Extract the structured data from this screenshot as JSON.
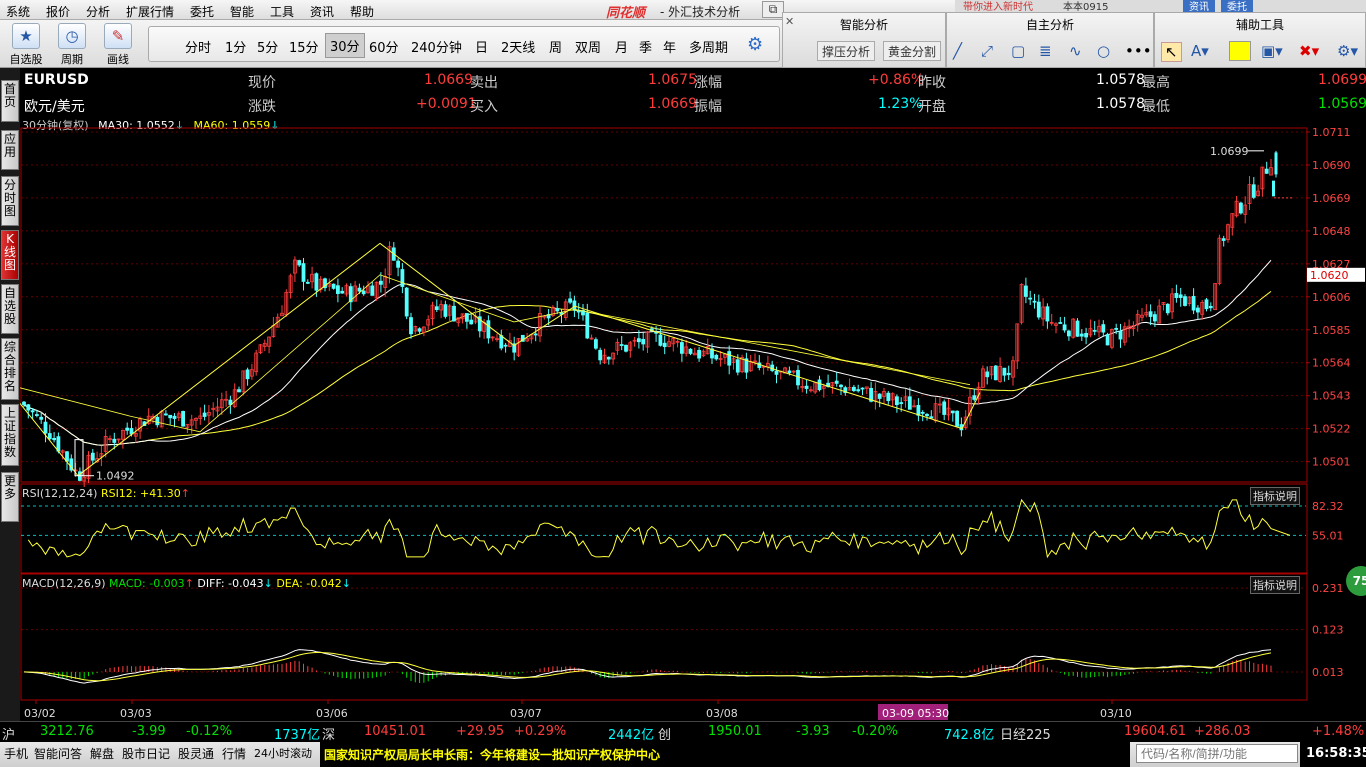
{
  "menu": [
    "系统",
    "报价",
    "分析",
    "扩展行情",
    "委托",
    "智能",
    "工具",
    "资讯",
    "帮助"
  ],
  "brand": "同花顺",
  "app_title": "- 外汇技术分析",
  "topright": {
    "t1": "带你进入新时代",
    "t2": "本本0915",
    "btn1": "资讯",
    "btn2": "委托"
  },
  "toolbar": {
    "tools": [
      {
        "label": "自选股",
        "icon": "star-icon"
      },
      {
        "label": "周期",
        "icon": "clock-icon"
      },
      {
        "label": "画线",
        "icon": "pen-icon"
      }
    ],
    "periods": [
      "分时",
      "1分",
      "5分",
      "15分",
      "30分",
      "60分",
      "240分钟",
      "日",
      "2天线",
      "周",
      "双周",
      "月",
      "季",
      "年",
      "多周期"
    ],
    "selected_period": "30分"
  },
  "panels": {
    "smart": {
      "title": "智能分析",
      "btn1": "撑压分析",
      "btn2": "黄金分割"
    },
    "self": {
      "title": "自主分析"
    },
    "aux": {
      "title": "辅助工具"
    }
  },
  "sidebar": [
    "首页",
    "应用",
    "分时图",
    "K线图",
    "自选股",
    "综合排名",
    "上证指数",
    "更多"
  ],
  "quote": {
    "symbol": "EURUSD",
    "name": "欧元/美元",
    "l_now": "现价",
    "now": "1.0669",
    "l_sell": "卖出",
    "sell": "1.0675",
    "l_pct": "涨幅",
    "pct": "+0.86%",
    "l_prev": "昨收",
    "prev": "1.0578",
    "l_high": "最高",
    "high": "1.0699",
    "l_chg": "涨跌",
    "chg": "+0.0091",
    "l_buy": "买入",
    "buy": "1.0669",
    "l_amp": "振幅",
    "amp": "1.23%",
    "l_open": "开盘",
    "open": "1.0578",
    "l_low": "最低",
    "low": "1.0569"
  },
  "ma_line": {
    "period": "30分钟(复权)",
    "ma30": "MA30: 1.0552",
    "ma60": "MA60: 1.0559"
  },
  "chart_data": {
    "type": "candlestick",
    "price_axis": [
      "1.0711",
      "1.0690",
      "1.0669",
      "1.0648",
      "1.0627",
      "1.0606",
      "1.0585",
      "1.0564",
      "1.0543",
      "1.0522",
      "1.0501"
    ],
    "price_range": [
      1.0488,
      1.0711
    ],
    "current_price_tag": "1.0620",
    "max_label": "1.0699",
    "min_label": "1.0492",
    "x_labels": [
      "03/02",
      "03/03",
      "03/06",
      "03/07",
      "03/08",
      "03/10"
    ],
    "cursor_label": "03-09 05:30",
    "rsi": {
      "label": "RSI(12,12,24)",
      "value": "RSI12: +41.30",
      "axis": [
        "82.32",
        "55.01"
      ]
    },
    "macd": {
      "label": "MACD(12,26,9)",
      "macd": "MACD: -0.003",
      "diff": "DIFF: -0.043",
      "dea": "DEA: -0.042",
      "axis": [
        "0.231",
        "0.123",
        "0.013"
      ]
    },
    "explain_btn": "指标说明"
  },
  "status": {
    "sh": "沪",
    "sh_val": "3212.76",
    "sh_chg": "-3.99",
    "sh_pct": "-0.12%",
    "sh_amt": "1737亿",
    "sz": "深",
    "sz_val": "10451.01",
    "sz_chg": "+29.95",
    "sz_pct": "+0.29%",
    "sz_amt": "2442亿",
    "cy": "创",
    "cy_val": "1950.01",
    "cy_chg": "-3.93",
    "cy_pct": "-0.20%",
    "cy_amt": "742.8亿",
    "nk": "日经225",
    "nk_val": "19604.61",
    "nk_chg": "+286.03",
    "nk_pct": "+1.48%"
  },
  "bottom": {
    "items": [
      "手机",
      "智能问答",
      "解盘",
      "股市日记",
      "股灵通",
      "行情",
      "24小时滚动"
    ],
    "ticker": "国家知识产权局局长申长雨：今年将建设一批知识产权保护中心",
    "search_placeholder": "代码/名称/简拼/功能",
    "clock": "16:58:35"
  },
  "badge": "75"
}
